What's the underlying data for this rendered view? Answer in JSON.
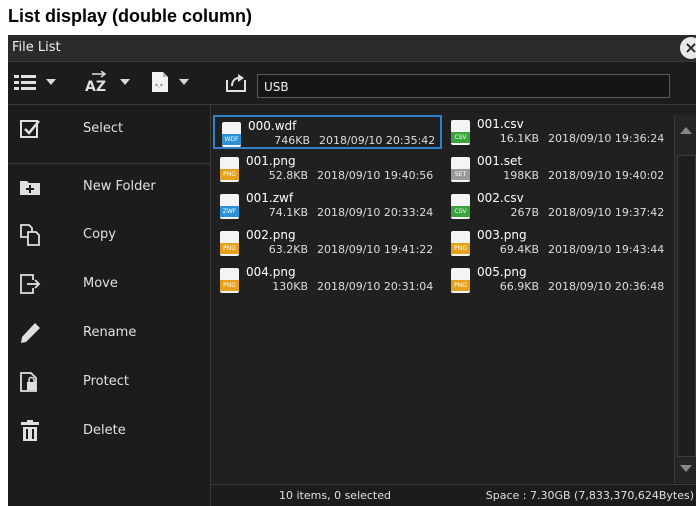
{
  "caption": "List display (double column)",
  "window": {
    "title": "File List",
    "close_label": "×"
  },
  "toolbar": {
    "view_icon": "list-view-icon",
    "sort_label": "AZ",
    "path": "USB"
  },
  "sidebar": {
    "items": [
      {
        "label": "Select",
        "icon": "checkbox-icon"
      },
      {
        "label": "New Folder",
        "icon": "new-folder-icon"
      },
      {
        "label": "Copy",
        "icon": "copy-icon"
      },
      {
        "label": "Move",
        "icon": "move-icon"
      },
      {
        "label": "Rename",
        "icon": "pencil-icon"
      },
      {
        "label": "Protect",
        "icon": "lock-icon"
      },
      {
        "label": "Delete",
        "icon": "trash-icon"
      }
    ]
  },
  "files": [
    {
      "name": "000.wdf",
      "size": "746KB",
      "date": "2018/09/10 20:35:42",
      "type": "WDF",
      "color": "#2e93d6",
      "selected": true
    },
    {
      "name": "001.csv",
      "size": "16.1KB",
      "date": "2018/09/10 19:36:24",
      "type": "CSV",
      "color": "#3aa43c"
    },
    {
      "name": "001.png",
      "size": "52.8KB",
      "date": "2018/09/10 19:40:56",
      "type": "PNG",
      "color": "#e6a11c"
    },
    {
      "name": "001.set",
      "size": "198KB",
      "date": "2018/09/10 19:40:02",
      "type": "SET",
      "color": "#9a9a9a"
    },
    {
      "name": "001.zwf",
      "size": "74.1KB",
      "date": "2018/09/10 20:33:24",
      "type": "ZWF",
      "color": "#2e93d6"
    },
    {
      "name": "002.csv",
      "size": "267B",
      "date": "2018/09/10 19:37:42",
      "type": "CSV",
      "color": "#3aa43c"
    },
    {
      "name": "002.png",
      "size": "63.2KB",
      "date": "2018/09/10 19:41:22",
      "type": "PNG",
      "color": "#e6a11c"
    },
    {
      "name": "003.png",
      "size": "69.4KB",
      "date": "2018/09/10 19:43:44",
      "type": "PNG",
      "color": "#e6a11c"
    },
    {
      "name": "004.png",
      "size": "130KB",
      "date": "2018/09/10 20:31:04",
      "type": "PNG",
      "color": "#e6a11c"
    },
    {
      "name": "005.png",
      "size": "66.9KB",
      "date": "2018/09/10 20:36:48",
      "type": "PNG",
      "color": "#e6a11c"
    }
  ],
  "status": {
    "items": "10 items, 0 selected",
    "space": "Space : 7.30GB (7,833,370,624Bytes)"
  }
}
